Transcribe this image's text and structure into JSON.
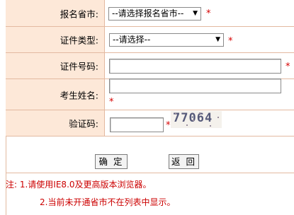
{
  "form": {
    "province": {
      "label": "报名省市:",
      "selected": "--请选择报名省市--"
    },
    "id_type": {
      "label": "证件类型:",
      "selected": "--请选择--"
    },
    "id_number": {
      "label": "证件号码:",
      "value": ""
    },
    "name": {
      "label": "考生姓名:",
      "value": ""
    },
    "captcha": {
      "label": "验证码:",
      "value": "",
      "image_text": "77064"
    },
    "required_mark": "*"
  },
  "buttons": {
    "confirm": "确 定",
    "back": "返 回"
  },
  "notes": {
    "line1": "注: 1.请使用IE8.0及更高版本浏览器。",
    "line2": "2.当前未开通省市不在列表中显示。"
  },
  "colors": {
    "label_bg": "#fde8d8",
    "border": "#e3b9a0",
    "required": "#d70000",
    "note": "#cc0000"
  }
}
